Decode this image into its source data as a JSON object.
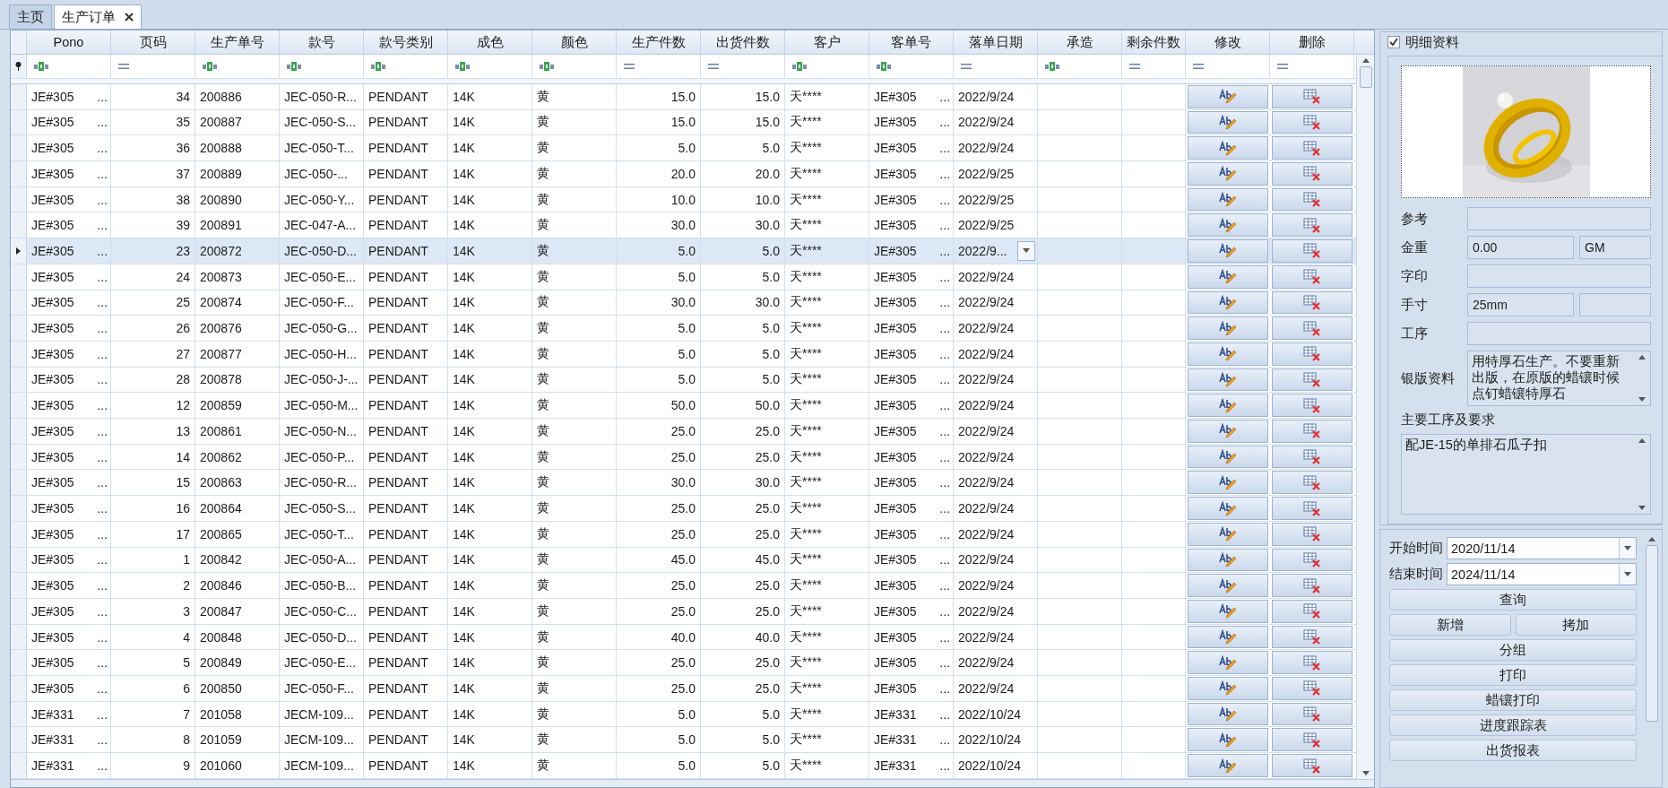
{
  "tabs": [
    {
      "label": "主页",
      "selected": false,
      "closable": false
    },
    {
      "label": "生产订单",
      "selected": true,
      "closable": true
    }
  ],
  "grid": {
    "columns": [
      {
        "label": "Pono",
        "kind": "text"
      },
      {
        "label": "页码",
        "kind": "number"
      },
      {
        "label": "生产单号",
        "kind": "text"
      },
      {
        "label": "款号",
        "kind": "text"
      },
      {
        "label": "款号类别",
        "kind": "text"
      },
      {
        "label": "成色",
        "kind": "text"
      },
      {
        "label": "颜色",
        "kind": "text"
      },
      {
        "label": "生产件数",
        "kind": "number"
      },
      {
        "label": "出货件数",
        "kind": "number"
      },
      {
        "label": "客户",
        "kind": "text"
      },
      {
        "label": "客单号",
        "kind": "text"
      },
      {
        "label": "落单日期",
        "kind": "date"
      },
      {
        "label": "承造",
        "kind": "text"
      },
      {
        "label": "剩余件数",
        "kind": "number"
      },
      {
        "label": "修改",
        "kind": "edit"
      },
      {
        "label": "删除",
        "kind": "delete"
      }
    ],
    "rows": [
      {
        "selected": false,
        "cells": [
          "JE#305 ...",
          "34",
          "200886",
          "JEC-050-R...",
          "PENDANT",
          "14K",
          "黄",
          "15.0",
          "15.0",
          "天****",
          "JE#305 ...",
          "2022/9/24"
        ]
      },
      {
        "selected": false,
        "cells": [
          "JE#305 ...",
          "35",
          "200887",
          "JEC-050-S...",
          "PENDANT",
          "14K",
          "黄",
          "15.0",
          "15.0",
          "天****",
          "JE#305 ...",
          "2022/9/24"
        ]
      },
      {
        "selected": false,
        "cells": [
          "JE#305 ...",
          "36",
          "200888",
          "JEC-050-T...",
          "PENDANT",
          "14K",
          "黄",
          "5.0",
          "5.0",
          "天****",
          "JE#305 ...",
          "2022/9/24"
        ]
      },
      {
        "selected": false,
        "cells": [
          "JE#305 ...",
          "37",
          "200889",
          "JEC-050-...",
          "PENDANT",
          "14K",
          "黄",
          "20.0",
          "20.0",
          "天****",
          "JE#305 ...",
          "2022/9/25"
        ]
      },
      {
        "selected": false,
        "cells": [
          "JE#305 ...",
          "38",
          "200890",
          "JEC-050-Y...",
          "PENDANT",
          "14K",
          "黄",
          "10.0",
          "10.0",
          "天****",
          "JE#305 ...",
          "2022/9/25"
        ]
      },
      {
        "selected": false,
        "cells": [
          "JE#305 ...",
          "39",
          "200891",
          "JEC-047-A...",
          "PENDANT",
          "14K",
          "黄",
          "30.0",
          "30.0",
          "天****",
          "JE#305 ...",
          "2022/9/25"
        ]
      },
      {
        "selected": true,
        "cells": [
          "JE#305 ...",
          "23",
          "200872",
          "JEC-050-D...",
          "PENDANT",
          "14K",
          "黄",
          "5.0",
          "5.0",
          "天****",
          "JE#305 ...",
          "2022/9..."
        ]
      },
      {
        "selected": false,
        "cells": [
          "JE#305 ...",
          "24",
          "200873",
          "JEC-050-E...",
          "PENDANT",
          "14K",
          "黄",
          "5.0",
          "5.0",
          "天****",
          "JE#305 ...",
          "2022/9/24"
        ]
      },
      {
        "selected": false,
        "cells": [
          "JE#305 ...",
          "25",
          "200874",
          "JEC-050-F...",
          "PENDANT",
          "14K",
          "黄",
          "30.0",
          "30.0",
          "天****",
          "JE#305 ...",
          "2022/9/24"
        ]
      },
      {
        "selected": false,
        "cells": [
          "JE#305 ...",
          "26",
          "200876",
          "JEC-050-G...",
          "PENDANT",
          "14K",
          "黄",
          "5.0",
          "5.0",
          "天****",
          "JE#305 ...",
          "2022/9/24"
        ]
      },
      {
        "selected": false,
        "cells": [
          "JE#305 ...",
          "27",
          "200877",
          "JEC-050-H...",
          "PENDANT",
          "14K",
          "黄",
          "5.0",
          "5.0",
          "天****",
          "JE#305 ...",
          "2022/9/24"
        ]
      },
      {
        "selected": false,
        "cells": [
          "JE#305 ...",
          "28",
          "200878",
          "JEC-050-J-...",
          "PENDANT",
          "14K",
          "黄",
          "5.0",
          "5.0",
          "天****",
          "JE#305 ...",
          "2022/9/24"
        ]
      },
      {
        "selected": false,
        "cells": [
          "JE#305 ...",
          "12",
          "200859",
          "JEC-050-M...",
          "PENDANT",
          "14K",
          "黄",
          "50.0",
          "50.0",
          "天****",
          "JE#305 ...",
          "2022/9/24"
        ]
      },
      {
        "selected": false,
        "cells": [
          "JE#305 ...",
          "13",
          "200861",
          "JEC-050-N...",
          "PENDANT",
          "14K",
          "黄",
          "25.0",
          "25.0",
          "天****",
          "JE#305 ...",
          "2022/9/24"
        ]
      },
      {
        "selected": false,
        "cells": [
          "JE#305 ...",
          "14",
          "200862",
          "JEC-050-P...",
          "PENDANT",
          "14K",
          "黄",
          "25.0",
          "25.0",
          "天****",
          "JE#305 ...",
          "2022/9/24"
        ]
      },
      {
        "selected": false,
        "cells": [
          "JE#305 ...",
          "15",
          "200863",
          "JEC-050-R...",
          "PENDANT",
          "14K",
          "黄",
          "30.0",
          "30.0",
          "天****",
          "JE#305 ...",
          "2022/9/24"
        ]
      },
      {
        "selected": false,
        "cells": [
          "JE#305 ...",
          "16",
          "200864",
          "JEC-050-S...",
          "PENDANT",
          "14K",
          "黄",
          "25.0",
          "25.0",
          "天****",
          "JE#305 ...",
          "2022/9/24"
        ]
      },
      {
        "selected": false,
        "cells": [
          "JE#305 ...",
          "17",
          "200865",
          "JEC-050-T...",
          "PENDANT",
          "14K",
          "黄",
          "25.0",
          "25.0",
          "天****",
          "JE#305 ...",
          "2022/9/24"
        ]
      },
      {
        "selected": false,
        "cells": [
          "JE#305 ...",
          "1",
          "200842",
          "JEC-050-A...",
          "PENDANT",
          "14K",
          "黄",
          "45.0",
          "45.0",
          "天****",
          "JE#305 ...",
          "2022/9/24"
        ]
      },
      {
        "selected": false,
        "cells": [
          "JE#305 ...",
          "2",
          "200846",
          "JEC-050-B...",
          "PENDANT",
          "14K",
          "黄",
          "25.0",
          "25.0",
          "天****",
          "JE#305 ...",
          "2022/9/24"
        ]
      },
      {
        "selected": false,
        "cells": [
          "JE#305 ...",
          "3",
          "200847",
          "JEC-050-C...",
          "PENDANT",
          "14K",
          "黄",
          "25.0",
          "25.0",
          "天****",
          "JE#305 ...",
          "2022/9/24"
        ]
      },
      {
        "selected": false,
        "cells": [
          "JE#305 ...",
          "4",
          "200848",
          "JEC-050-D...",
          "PENDANT",
          "14K",
          "黄",
          "40.0",
          "40.0",
          "天****",
          "JE#305 ...",
          "2022/9/24"
        ]
      },
      {
        "selected": false,
        "cells": [
          "JE#305 ...",
          "5",
          "200849",
          "JEC-050-E...",
          "PENDANT",
          "14K",
          "黄",
          "25.0",
          "25.0",
          "天****",
          "JE#305 ...",
          "2022/9/24"
        ]
      },
      {
        "selected": false,
        "cells": [
          "JE#305 ...",
          "6",
          "200850",
          "JEC-050-F...",
          "PENDANT",
          "14K",
          "黄",
          "25.0",
          "25.0",
          "天****",
          "JE#305 ...",
          "2022/9/24"
        ]
      },
      {
        "selected": false,
        "cells": [
          "JE#331 ...",
          "7",
          "201058",
          "JECM-109...",
          "PENDANT",
          "14K",
          "黄",
          "5.0",
          "5.0",
          "天****",
          "JE#331 ...",
          "2022/10/24"
        ]
      },
      {
        "selected": false,
        "cells": [
          "JE#331 ...",
          "8",
          "201059",
          "JECM-109...",
          "PENDANT",
          "14K",
          "黄",
          "5.0",
          "5.0",
          "天****",
          "JE#331 ...",
          "2022/10/24"
        ]
      },
      {
        "selected": false,
        "cells": [
          "JE#331 ...",
          "9",
          "201060",
          "JECM-109...",
          "PENDANT",
          "14K",
          "黄",
          "5.0",
          "5.0",
          "天****",
          "JE#331 ...",
          "2022/10/24"
        ]
      }
    ]
  },
  "detail": {
    "title": "明细资料",
    "checked": true,
    "fields": [
      {
        "kind": "single",
        "label": "参考"
      },
      {
        "kind": "pair",
        "label": "金重",
        "value": "0.00",
        "unit": "GM"
      },
      {
        "kind": "single",
        "label": "字印"
      },
      {
        "kind": "pair",
        "label": "手寸",
        "value": "25mm"
      },
      {
        "kind": "single",
        "label": "工序"
      },
      {
        "kind": "memo",
        "label": "银版资料",
        "value": "用特厚石生产。不要重新出版，在原版的蜡镶时候点钉蜡镶特厚石"
      }
    ],
    "requirements": {
      "label": "主要工序及要求",
      "value": "配JE-15的单排石瓜子扣"
    }
  },
  "query": {
    "dates": [
      {
        "label": "开始时间",
        "value": "2020/11/14"
      },
      {
        "label": "结束时间",
        "value": "2024/11/14"
      }
    ],
    "buttons": [
      [
        "查询"
      ],
      [
        "新增",
        "拷加"
      ],
      [
        "分组"
      ],
      [
        "打印"
      ],
      [
        "蜡镶打印"
      ],
      [
        "进度跟踪表"
      ],
      [
        "出货报表"
      ]
    ]
  }
}
